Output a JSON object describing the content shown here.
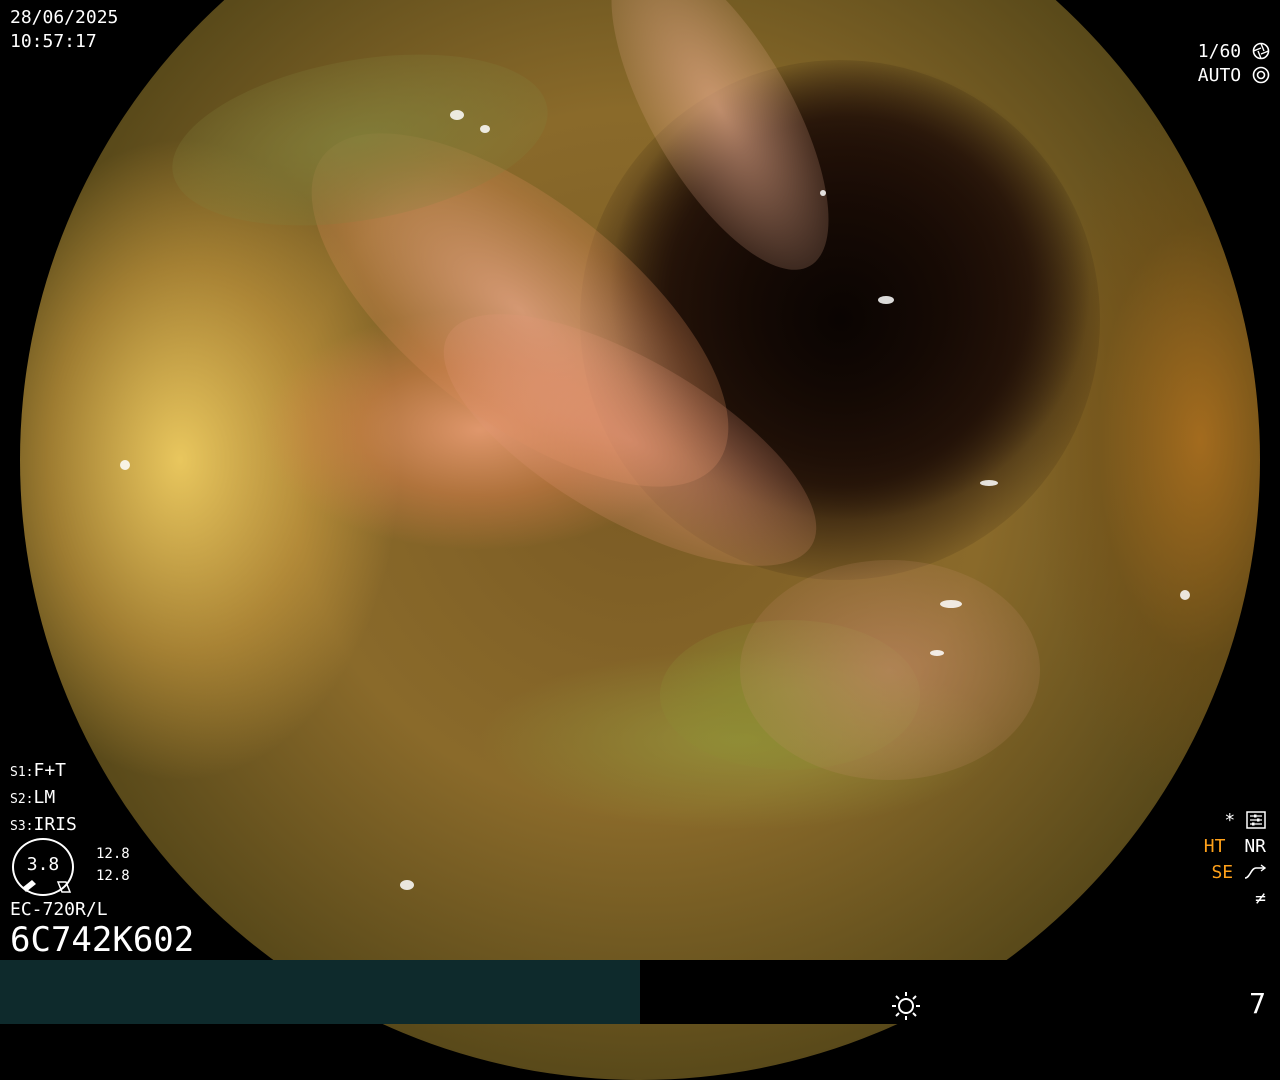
{
  "overlay": {
    "date": "28/06/2025",
    "time": "10:57:17",
    "shutter": "1/60",
    "iris_mode": "AUTO",
    "settings": [
      {
        "key": "S1:",
        "value": "F+T"
      },
      {
        "key": "S2:",
        "value": "LM"
      },
      {
        "key": "S3:",
        "value": "IRIS"
      }
    ],
    "scale_value": "3.8",
    "scale_top": "12.8",
    "scale_bottom": "12.8",
    "scope_model": "EC-720R/L",
    "serial": "6C742K602",
    "indicators": {
      "star": "*",
      "ht": "HT",
      "nr": "NR",
      "se": "SE",
      "misc": "≠"
    },
    "page_number": "7"
  },
  "icons": [
    "shutter-icon",
    "auto-iris-icon",
    "settings-icon",
    "brightness-icon",
    "endoscope-scale-icon"
  ],
  "colors": {
    "accent_orange": "#ffa11a",
    "bottom_bar": "#0e2a2c"
  }
}
